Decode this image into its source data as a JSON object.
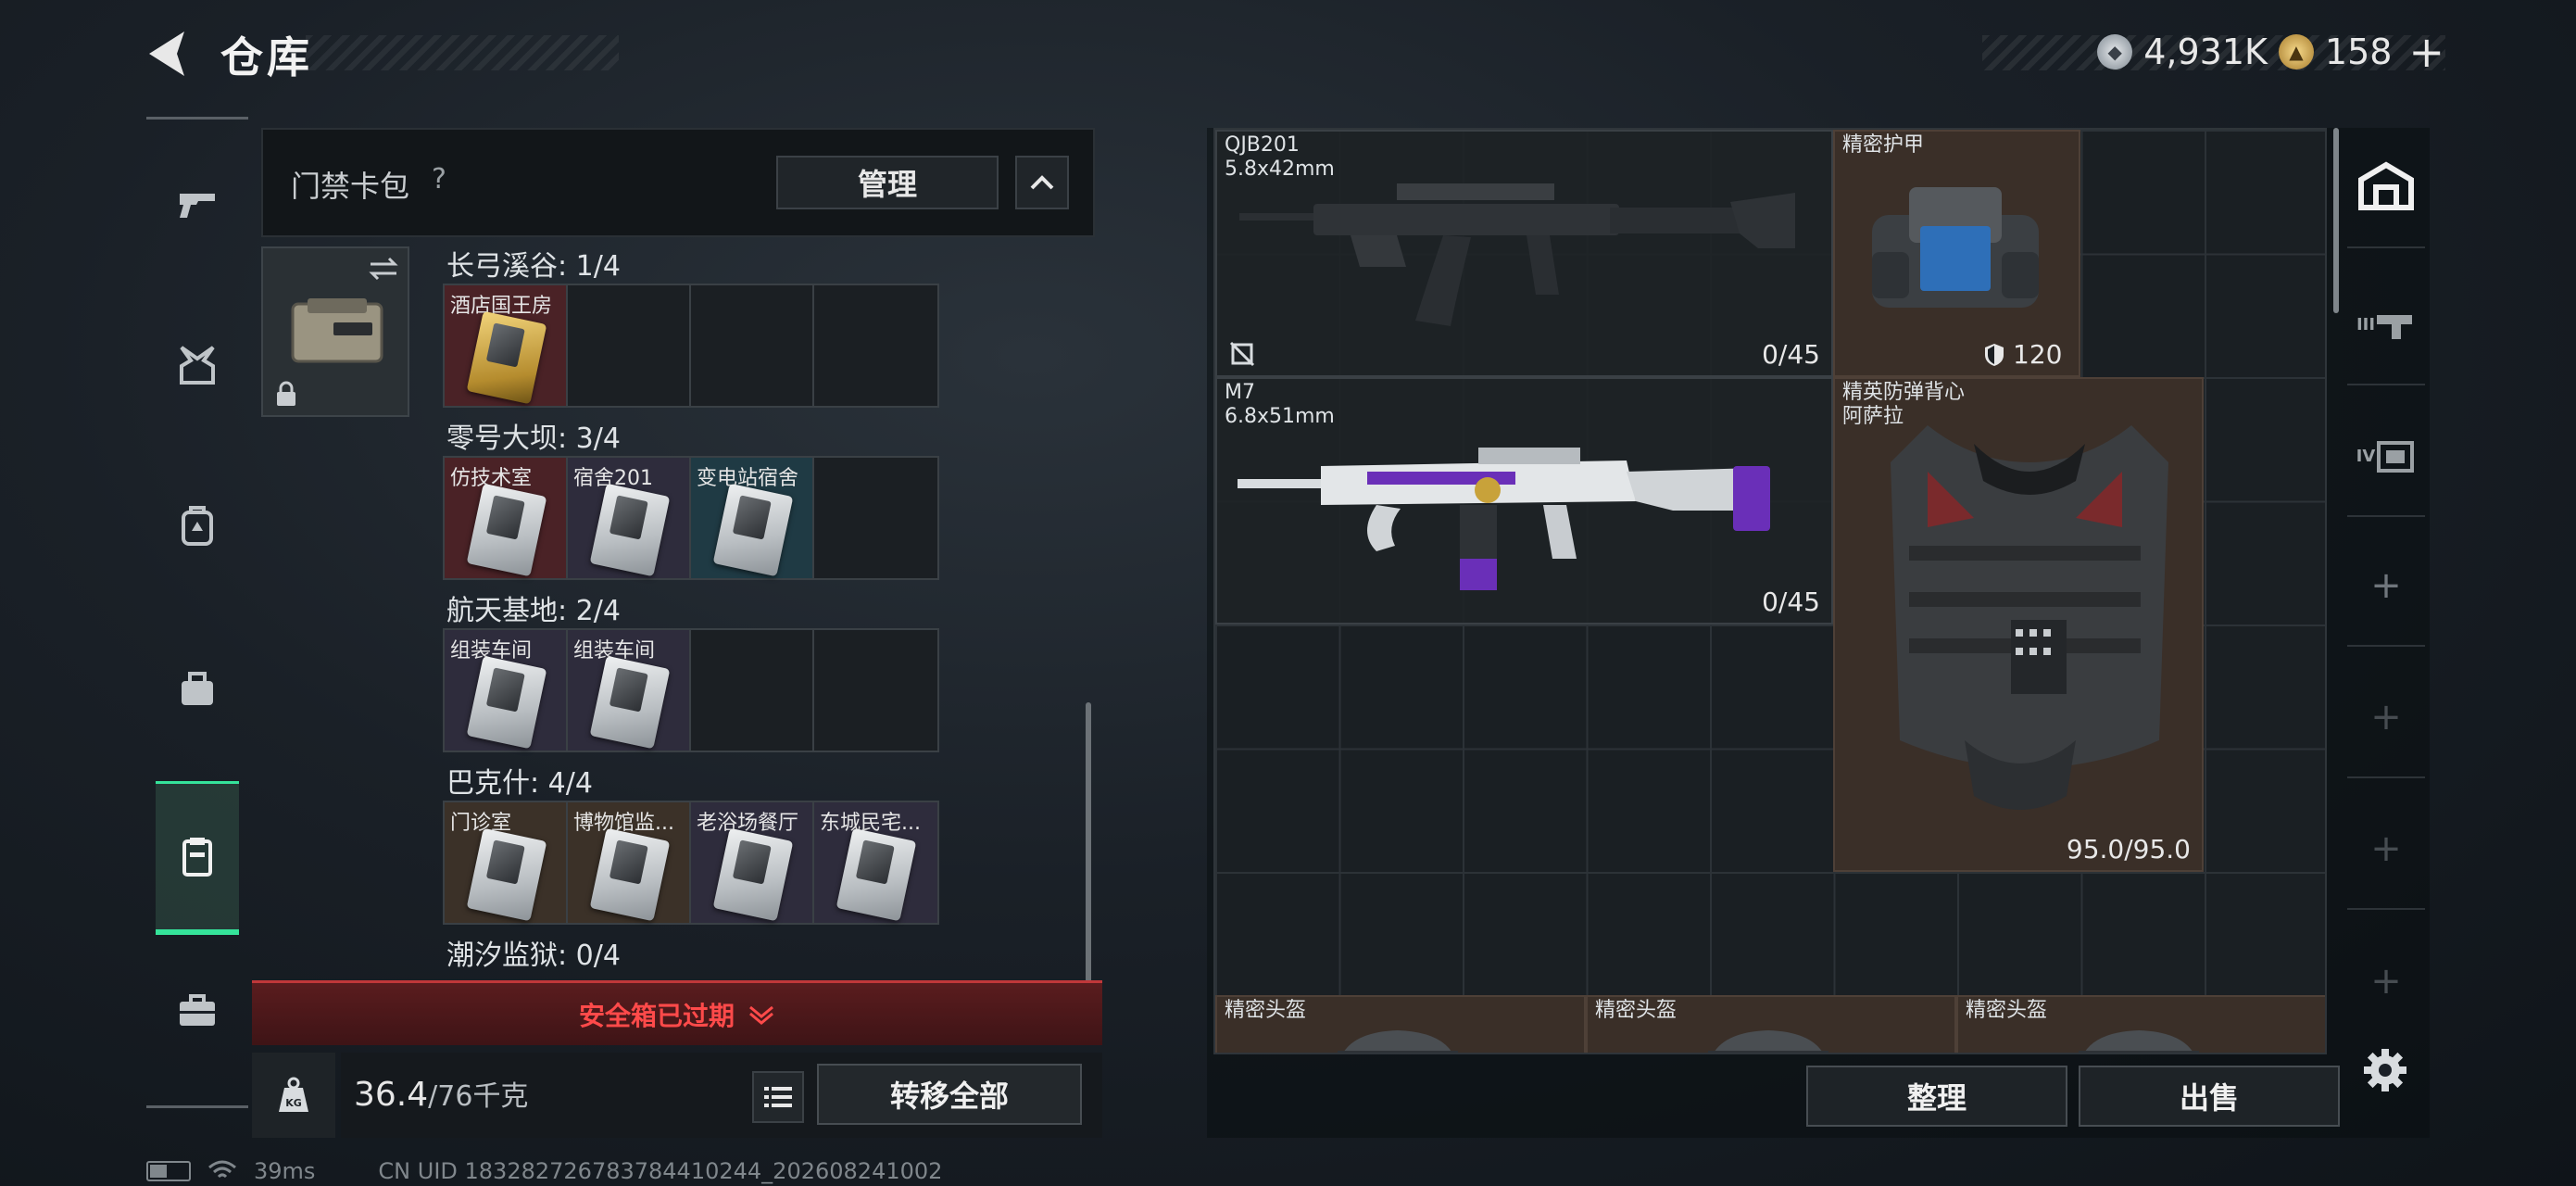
{
  "header": {
    "title": "仓库",
    "currency_silver": "4,931K",
    "currency_gold": "158",
    "plus_label": "+"
  },
  "left_nav": {
    "items": [
      {
        "icon": "pistol-icon"
      },
      {
        "icon": "chest-rig-icon"
      },
      {
        "icon": "backpack-icon"
      },
      {
        "icon": "bag-icon"
      },
      {
        "icon": "keycard-case-icon",
        "active": true
      },
      {
        "icon": "briefcase-icon"
      }
    ]
  },
  "keycard_pack": {
    "label": "门禁卡包",
    "help": "?",
    "manage": "管理",
    "regions": [
      {
        "title": "长弓溪谷: 1/4",
        "slots": [
          {
            "label": "酒店国王房",
            "color": "red",
            "card": "gold"
          },
          {},
          {},
          {}
        ]
      },
      {
        "title": "零号大坝: 3/4",
        "slots": [
          {
            "label": "仿技术室",
            "color": "red",
            "card": "silver"
          },
          {
            "label": "宿舍201",
            "color": "purple",
            "card": "silver"
          },
          {
            "label": "变电站宿舍",
            "color": "teal",
            "card": "silver"
          },
          {}
        ]
      },
      {
        "title": "航天基地: 2/4",
        "slots": [
          {
            "label": "组装车间",
            "color": "purple",
            "card": "silver"
          },
          {
            "label": "组装车间",
            "color": "purple",
            "card": "silver"
          },
          {},
          {}
        ]
      },
      {
        "title": "巴克什: 4/4",
        "slots": [
          {
            "label": "门诊室",
            "color": "olive",
            "card": "silver"
          },
          {
            "label": "博物馆监...",
            "color": "olive",
            "card": "silver"
          },
          {
            "label": "老浴场餐厅",
            "color": "purple",
            "card": "silver"
          },
          {
            "label": "东城民宅...",
            "color": "purple",
            "card": "silver"
          }
        ]
      },
      {
        "title": "潮汐监狱: 0/4",
        "slots": []
      }
    ],
    "expired_text": "安全箱已过期",
    "weight_value": "36.4",
    "weight_max": "/76千克",
    "transfer_all": "转移全部"
  },
  "stash": {
    "items": [
      {
        "name": "QJB201",
        "sub": "5.8x42mm",
        "stat": "0/45",
        "kind": "gun"
      },
      {
        "name": "精密护甲",
        "stat": "120",
        "kind": "armor"
      },
      {
        "name": "M7",
        "sub": "6.8x51mm",
        "stat": "0/45",
        "kind": "gun"
      },
      {
        "name": "精英防弹背心",
        "sub": "阿萨拉",
        "stat": "95.0/95.0",
        "kind": "vest"
      },
      {
        "name": "精密头盔",
        "kind": "helmet"
      },
      {
        "name": "精密头盔",
        "kind": "helmet"
      },
      {
        "name": "精密头盔",
        "kind": "helmet"
      }
    ],
    "tidy": "整理",
    "sell": "出售"
  },
  "side_tabs": {
    "tab_3": "III",
    "tab_4": "IV",
    "add": "+"
  },
  "status_bar": {
    "ping": "39ms",
    "uid": "CN UID 183282726783784410244_202608241002"
  },
  "colors": {
    "accent_green": "#35e39a",
    "expired_red": "#ff4a4a"
  }
}
